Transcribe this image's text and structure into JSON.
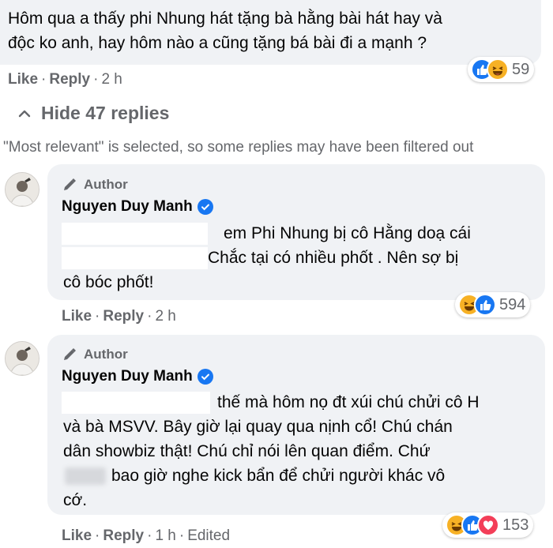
{
  "top_comment": {
    "line1": "Hôm qua a thấy phi Nhung hát tặng bà hằng bài hát hay và",
    "line2": "độc ko anh, hay hôm nào a cũng tặng bá bài đi a mạnh ?",
    "like": "Like",
    "reply": "Reply",
    "time": "2 h",
    "reaction_count": "59",
    "reaction_icons": [
      "like-icon",
      "haha-icon"
    ]
  },
  "hide_replies": "Hide 47 replies",
  "filter_note": "\"Most relevant\" is selected, so some replies may have been filtered out",
  "replies": [
    {
      "badge": "Author",
      "name": "Nguyen Duy Manh",
      "lines": [
        "em Phi Nhung bị cô Hằng doạ cái",
        "Chắc tại có nhiều phốt . Nên sợ bị",
        "cô bóc phốt!"
      ],
      "like": "Like",
      "reply": "Reply",
      "time": "2 h",
      "reaction_count": "594",
      "reaction_icons": [
        "haha-icon",
        "like-icon"
      ]
    },
    {
      "badge": "Author",
      "name": "Nguyen Duy Manh",
      "lines": [
        "thế mà hôm nọ đt xúi chú chửi cô H",
        "và bà MSVV. Bây giờ lại quay qua nịnh cổ! Chú chán",
        "dân showbiz thật! Chú chỉ nói lên quan điểm. Chứ",
        "bao giờ nghe kick bẩn để chửi người khác vô",
        "cớ."
      ],
      "like": "Like",
      "reply": "Reply",
      "time": "1 h",
      "edited": "Edited",
      "reaction_count": "153",
      "reaction_icons": [
        "haha-icon",
        "like-icon",
        "love-icon"
      ]
    }
  ],
  "colors": {
    "bubble": "#f0f2f5",
    "meta": "#65676b",
    "like_blue": "#1877f2",
    "haha": "#f7b125",
    "love": "#f33e58"
  }
}
